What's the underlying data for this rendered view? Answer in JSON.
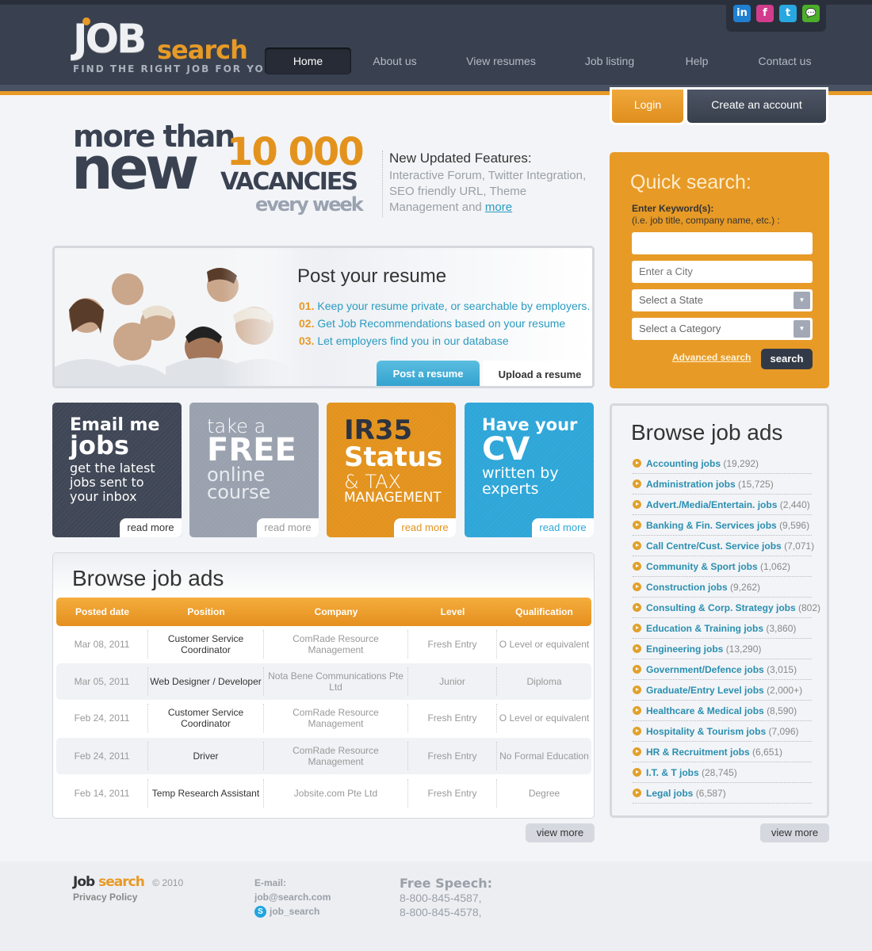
{
  "header": {
    "logo": {
      "word1": "JOB",
      "word2": "search",
      "tagline": "FIND THE RIGHT JOB FOR YOU!"
    },
    "nav": [
      {
        "label": "Home",
        "active": true
      },
      {
        "label": "About us"
      },
      {
        "label": "View resumes"
      },
      {
        "label": "Job listing"
      },
      {
        "label": "Help"
      },
      {
        "label": "Contact us"
      }
    ],
    "social": [
      {
        "name": "linkedin-icon",
        "glyph": "in",
        "color": "#1f7fd0"
      },
      {
        "name": "facebook-icon",
        "glyph": "f",
        "color": "#d23c8c"
      },
      {
        "name": "twitter-icon",
        "glyph": "t",
        "color": "#29a7e1"
      },
      {
        "name": "chat-icon",
        "glyph": "💬",
        "color": "#4cae2a"
      }
    ],
    "login_label": "Login",
    "create_account_label": "Create an account"
  },
  "hero": {
    "line1": "more than",
    "line2": "new",
    "number": "10 000",
    "vacancies": "VACANCIES",
    "every_week": "every week",
    "features_title": "New Updated Features:",
    "features_text": "Interactive Forum, Twitter Integration, SEO friendly URL, Theme Management and",
    "features_more": "more"
  },
  "resume": {
    "title": "Post your resume",
    "items": [
      {
        "num": "01.",
        "text": "Keep your resume private, or searchable by employers."
      },
      {
        "num": "02.",
        "text": "Get Job Recommendations based on your resume"
      },
      {
        "num": "03.",
        "text": "Let employers find you in our database"
      }
    ],
    "tab_post": "Post a resume",
    "tab_upload": "Upload a resume"
  },
  "tiles": [
    {
      "l1": "Email me",
      "l2": "jobs",
      "l3": "get the latest",
      "l4": "jobs sent to",
      "l5": "your inbox",
      "read_more": "read more",
      "color": "#3f4655"
    },
    {
      "l1": "take a",
      "l2": "FREE",
      "l3": "online",
      "l4": "course",
      "read_more": "read more",
      "color": "#9aa1ae"
    },
    {
      "l1": "IR35",
      "l2": "Status",
      "l3": "& TAX",
      "l4": "MANAGEMENT",
      "read_more": "read more",
      "color": "#e3931d"
    },
    {
      "l1": "Have your",
      "l2": "CV",
      "l3": "written by",
      "l4": "experts",
      "read_more": "read more",
      "color": "#2ea6d8"
    }
  ],
  "jobs_table": {
    "title": "Browse job ads",
    "columns": [
      "Posted date",
      "Position",
      "Company",
      "Level",
      "Qualification"
    ],
    "rows": [
      [
        "Mar 08, 2011",
        "Customer Service Coordinator",
        "ComRade Resource Management",
        "Fresh Entry",
        "O Level or equivalent"
      ],
      [
        "Mar 05, 2011",
        "Web Designer / Developer",
        "Nota Bene Communications Pte Ltd",
        "Junior",
        "Diploma"
      ],
      [
        "Feb 24, 2011",
        "Customer Service Coordinator",
        "ComRade Resource Management",
        "Fresh Entry",
        "O Level or equivalent"
      ],
      [
        "Feb 24, 2011",
        "Driver",
        "ComRade Resource Management",
        "Fresh Entry",
        "No Formal Education"
      ],
      [
        "Feb 14, 2011",
        "Temp Research Assistant",
        "Jobsite.com Pte Ltd",
        "Fresh Entry",
        "Degree"
      ]
    ],
    "view_more": "view more"
  },
  "quick_search": {
    "title": "Quick search:",
    "keyword_label": "Enter Keyword(s):",
    "keyword_hint": "(i.e. job title, company name, etc.) :",
    "keyword_value": "",
    "city_placeholder": "Enter a City",
    "state_selected": "Select a State",
    "category_selected": "Select a Category",
    "advanced_label": "Advanced search",
    "search_label": "search"
  },
  "categories": {
    "title": "Browse job ads",
    "items": [
      {
        "name": "Accounting jobs",
        "count": "(19,292)"
      },
      {
        "name": "Administration jobs",
        "count": "(15,725)"
      },
      {
        "name": "Advert./Media/Entertain. jobs",
        "count": "(2,440)"
      },
      {
        "name": "Banking & Fin. Services jobs",
        "count": "(9,596)"
      },
      {
        "name": "Call Centre/Cust. Service jobs",
        "count": "(7,071)"
      },
      {
        "name": "Community & Sport jobs",
        "count": "(1,062)"
      },
      {
        "name": "Construction jobs",
        "count": "(9,262)"
      },
      {
        "name": "Consulting & Corp. Strategy jobs",
        "count": "(802)"
      },
      {
        "name": "Education & Training jobs",
        "count": "(3,860)"
      },
      {
        "name": "Engineering jobs",
        "count": "(13,290)"
      },
      {
        "name": "Government/Defence jobs",
        "count": "(3,015)"
      },
      {
        "name": "Graduate/Entry Level jobs",
        "count": "(2,000+)"
      },
      {
        "name": "Healthcare & Medical jobs",
        "count": "(8,590)"
      },
      {
        "name": "Hospitality & Tourism jobs",
        "count": "(7,096)"
      },
      {
        "name": "HR & Recruitment jobs",
        "count": "(6,651)"
      },
      {
        "name": "I.T. & T jobs",
        "count": "(28,745)"
      },
      {
        "name": "Legal jobs",
        "count": "(6,587)"
      }
    ],
    "view_more": "view more"
  },
  "footer": {
    "logo_word1": "Job",
    "logo_word2": "search",
    "copyright": "© 2010",
    "privacy": "Privacy Policy",
    "email_label": "E-mail:",
    "email": "job@search.com",
    "skype": "job_search",
    "phone_title": "Free Speech:",
    "phones": [
      "8-800-845-4587,",
      "8-800-845-4578,"
    ]
  }
}
